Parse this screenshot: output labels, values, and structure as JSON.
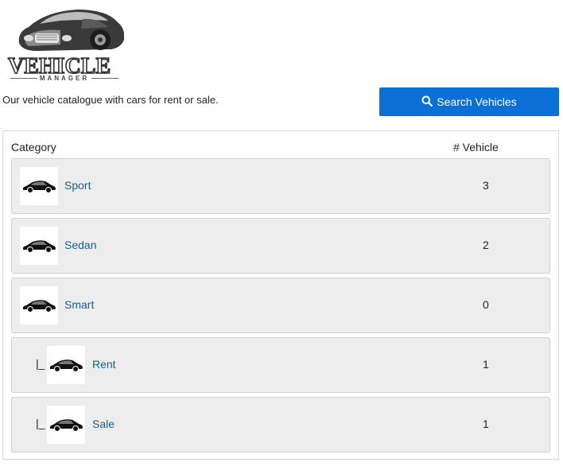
{
  "header": {
    "logo_word": "VEHICLE",
    "logo_sub": "MANAGER",
    "tagline": "Our vehicle catalogue with cars for rent or sale.",
    "search_label": "Search Vehicles",
    "search_icon": "search-icon"
  },
  "table": {
    "col_category": "Category",
    "col_count": "# Vehicle",
    "rows": [
      {
        "prefix": "",
        "label": "Sport",
        "count": "3",
        "icon": "car-icon"
      },
      {
        "prefix": "",
        "label": "Sedan",
        "count": "2",
        "icon": "car-icon"
      },
      {
        "prefix": "",
        "label": "Smart",
        "count": "0",
        "icon": "car-icon"
      },
      {
        "prefix": "|_",
        "label": "Rent",
        "count": "1",
        "icon": "car-icon"
      },
      {
        "prefix": "|_",
        "label": "Sale",
        "count": "1",
        "icon": "car-icon"
      }
    ]
  },
  "colors": {
    "accent": "#0a6fd6",
    "link": "#1a5d8f",
    "row_bg": "#ededed"
  }
}
